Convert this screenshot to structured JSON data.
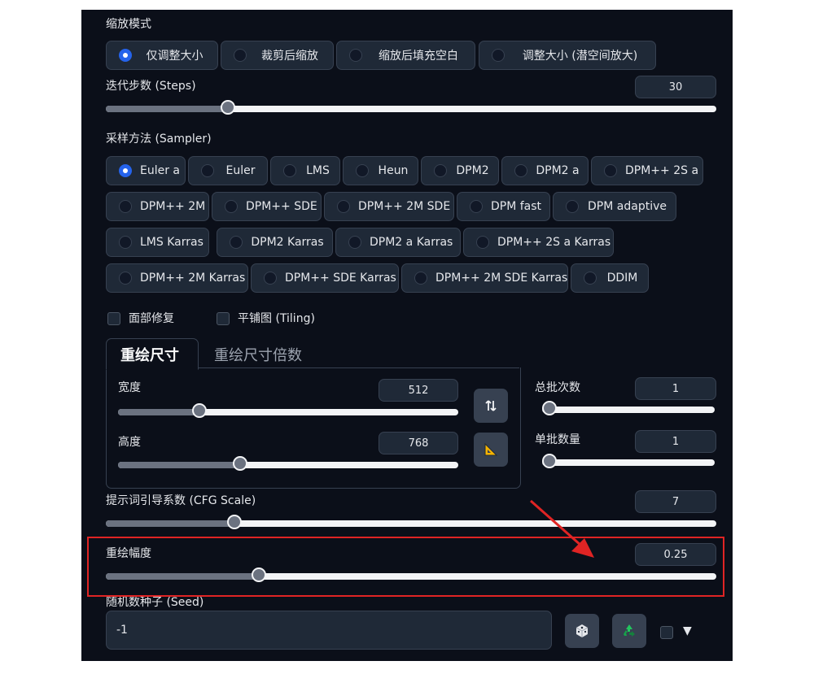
{
  "resize_mode": {
    "label": "缩放模式",
    "options": [
      "仅调整大小",
      "裁剪后缩放",
      "缩放后填充空白",
      "调整大小 (潜空间放大)"
    ],
    "selected": "仅调整大小"
  },
  "steps": {
    "label": "迭代步数 (Steps)",
    "value": "30",
    "fraction": 0.2
  },
  "sampler": {
    "label": "采样方法 (Sampler)",
    "options": [
      "Euler a",
      "Euler",
      "LMS",
      "Heun",
      "DPM2",
      "DPM2 a",
      "DPM++ 2S a",
      "DPM++ 2M",
      "DPM++ SDE",
      "DPM++ 2M SDE",
      "DPM fast",
      "DPM adaptive",
      "LMS Karras",
      "DPM2 Karras",
      "DPM2 a Karras",
      "DPM++ 2S a Karras",
      "DPM++ 2M Karras",
      "DPM++ SDE Karras",
      "DPM++ 2M SDE Karras",
      "DDIM"
    ],
    "selected": "Euler a"
  },
  "checkboxes": {
    "face_restore": "面部修复",
    "tiling": "平铺图 (Tiling)"
  },
  "tabs": {
    "active": "重绘尺寸",
    "inactive": "重绘尺寸倍数"
  },
  "width": {
    "label": "宽度",
    "value": "512",
    "fraction": 0.24
  },
  "height": {
    "label": "高度",
    "value": "768",
    "fraction": 0.36
  },
  "batch_count": {
    "label": "总批次数",
    "value": "1",
    "fraction": 0.0
  },
  "batch_size": {
    "label": "单批数量",
    "value": "1",
    "fraction": 0.0
  },
  "cfg": {
    "label": "提示词引导系数 (CFG Scale)",
    "value": "7",
    "fraction": 0.21
  },
  "denoise": {
    "label": "重绘幅度",
    "value": "0.25",
    "fraction": 0.25
  },
  "seed": {
    "label": "随机数种子 (Seed)",
    "value": "-1"
  },
  "icons": {
    "swap": "swap-dimensions-icon",
    "ratio": "triangle-ruler-icon",
    "dice": "dice-icon",
    "recycle": "recycle-icon",
    "dropdown": "triangle-down-icon"
  },
  "colors": {
    "panel_bg": "#0b0f19",
    "radio_selected": "#2563eb",
    "highlight_border": "#e02424",
    "arrow": "#e02424"
  }
}
